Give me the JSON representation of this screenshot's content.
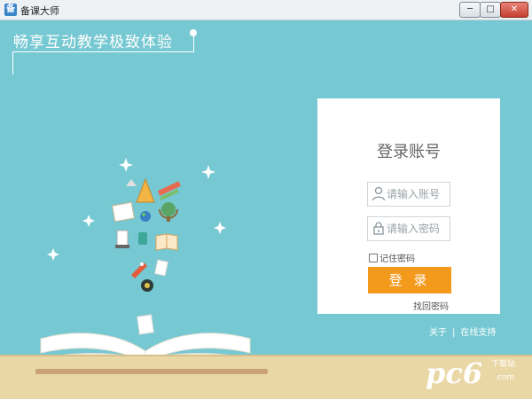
{
  "window": {
    "title": "备课大师",
    "minimize_symbol": "─",
    "maximize_symbol": "□",
    "close_symbol": "✕"
  },
  "slogan": "畅享互动教学极致体验",
  "login": {
    "title": "登录账号",
    "username_placeholder": "请输入账号",
    "password_placeholder": "请输入密码",
    "remember_label": "记住密码",
    "login_button": "登 录",
    "forgot_link": "找回密码"
  },
  "footer": {
    "about": "关于",
    "separator": "|",
    "support": "在线支持"
  },
  "watermark": {
    "logo": "pc6",
    "site": "下载站",
    "domain": ".com"
  },
  "colors": {
    "background": "#76c8d2",
    "accent": "#f39a1c",
    "floor": "#ead7a6"
  }
}
